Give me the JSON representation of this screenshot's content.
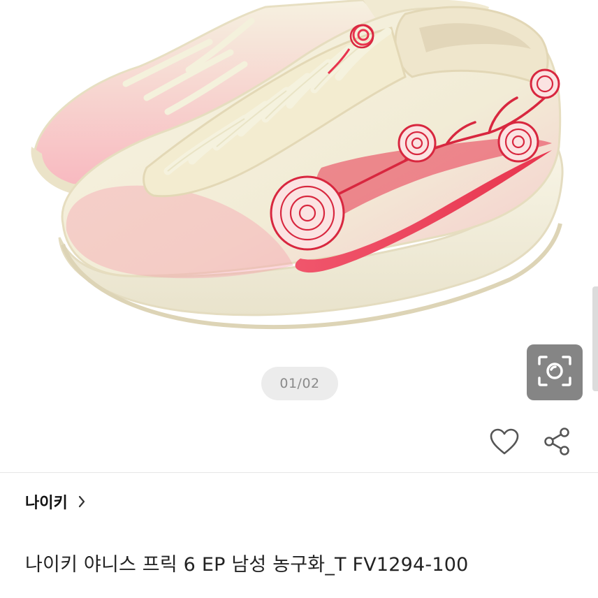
{
  "gallery": {
    "page_indicator": "01/02",
    "current_page": 1,
    "total_pages": 2
  },
  "icons": {
    "lens": "lens-search-icon",
    "favorite": "heart-icon",
    "share": "share-icon",
    "brand_arrow": "chevron-right-icon"
  },
  "product": {
    "brand": "나이키",
    "title": "나이키 야니스 프릭 6 EP 남성 농구화_T FV1294-100"
  },
  "colors": {
    "shoe_base": "#f3efd8",
    "accent_red": "#e8344e",
    "lens_button_bg": "#858585",
    "indicator_bg": "#ececec"
  }
}
